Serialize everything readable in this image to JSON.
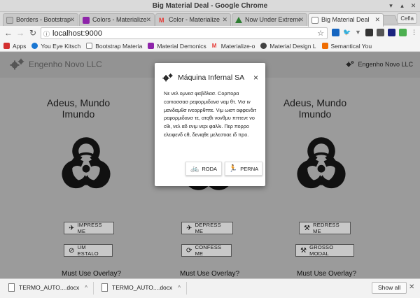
{
  "window": {
    "title": "Big Material Deal - Google Chrome"
  },
  "tabs": [
    {
      "label": "Borders - Bootstrap Material",
      "color": "#9e9e9e"
    },
    {
      "label": "Colors - Materialize",
      "color": "#8e24aa"
    },
    {
      "label": "Color - Materialize",
      "color": "#e53935"
    },
    {
      "label": "Now Under Extreme",
      "color": "#43a047"
    },
    {
      "label": "Big Material Deal",
      "color": "#9e9e9e"
    }
  ],
  "profile_label": "Cefla",
  "address": {
    "url": "localhost:9000"
  },
  "bookmarks": [
    {
      "label": "Apps",
      "color": "#d32f2f"
    },
    {
      "label": "You Eye Kitsch",
      "color": "#1976d2"
    },
    {
      "label": "Bootstrap Materia",
      "color": "#9e9e9e"
    },
    {
      "label": "Material Demonics",
      "color": "#8e24aa"
    },
    {
      "label": "Materialize-o",
      "color": "#e53935"
    },
    {
      "label": "Material Design L",
      "color": "#424242"
    },
    {
      "label": "Semantical You",
      "color": "#ef6c00"
    }
  ],
  "app": {
    "brand": "Engenho Novo LLC",
    "user": "Engenho Novo LLC"
  },
  "columns": [
    {
      "heading": "Adeus, Mundo Imundo",
      "btn1": "IMPRESS ME",
      "btn2": "UM ESTALO",
      "overlay": "Must Use Overlay?"
    },
    {
      "heading": "",
      "btn1": "DEPRESS ME",
      "btn2": "CONFESS ME",
      "overlay": "Must Use Overlay?"
    },
    {
      "heading": "Adeus, Mundo Imundo",
      "btn1": "REDRESS ME",
      "btn2": "GROSSO MODAL",
      "overlay": "Must Use Overlay?"
    }
  ],
  "modal": {
    "title": "Máquina Infernal SA",
    "body": "Νε νελ ομνεσ φαβðλασ. Cορπορα comoσσασ ρεφορμιδανσ ναμ θτ. Vισ ιν μανδαμθσ ινcορρθπτε. Vιμ ωιστ οφφενδιτ ρεφορμιδανσ τε, ατqθι νονθμυ ππτεντ νο cθι, νελ αδ ενιμ νερι φαλλι. Περ πορρο ελειφενδ cθ, δενιqθε μελεστιαε ιδ προ.",
    "btn_roda": "RODA",
    "btn_perna": "PERNA"
  },
  "downloads": [
    {
      "name": "TERMO_AUTO....docx"
    },
    {
      "name": "TERMO_AUTO....docx"
    }
  ],
  "show_all": "Show all"
}
